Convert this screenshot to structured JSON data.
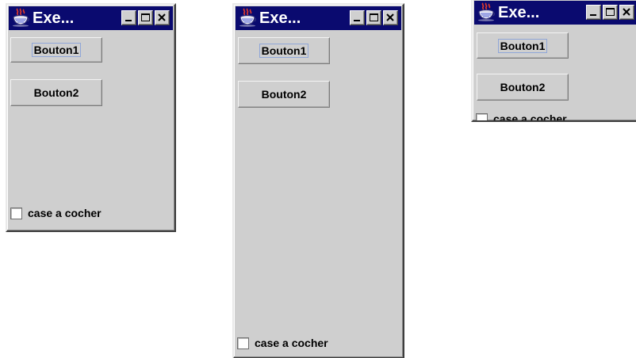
{
  "windows": [
    {
      "title": "Exe...",
      "button1": "Bouton1",
      "button2": "Bouton2",
      "checkbox_label": "case a cocher",
      "checkbox_checked": false
    },
    {
      "title": "Exe...",
      "button1": "Bouton1",
      "button2": "Bouton2",
      "checkbox_label": "case a cocher",
      "checkbox_checked": false
    },
    {
      "title": "Exe...",
      "button1": "Bouton1",
      "button2": "Bouton2",
      "checkbox_label": "case a cocher",
      "checkbox_checked": false
    }
  ],
  "theme": {
    "titlebar_color": "#0a0a6f",
    "window_background": "#cfcfcf",
    "focus_outline_color": "#8fa6d8"
  },
  "icons": {
    "app": "java-coffee-cup-icon",
    "minimize": "minimize-icon",
    "maximize": "maximize-icon",
    "close": "close-icon"
  }
}
